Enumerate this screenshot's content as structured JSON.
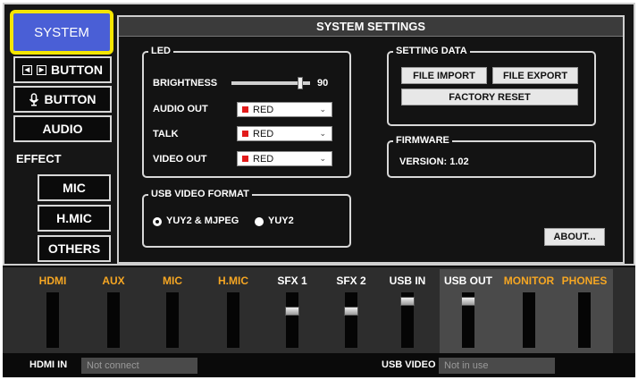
{
  "nav": {
    "system": "SYSTEM",
    "button": "BUTTON",
    "vbutton": "BUTTON",
    "audio": "AUDIO",
    "effect": "EFFECT",
    "mic": "MIC",
    "hmic": "H.MIC",
    "others": "OTHERS"
  },
  "main": {
    "title": "SYSTEM SETTINGS"
  },
  "led": {
    "title": "LED",
    "brightness_label": "BRIGHTNESS",
    "brightness_value": "90",
    "brightness_level": 0.9,
    "audio_out_label": "AUDIO OUT",
    "audio_out_value": "RED",
    "talk_label": "TALK",
    "talk_value": "RED",
    "video_out_label": "VIDEO OUT",
    "video_out_value": "RED",
    "swatch_color": "#e21b1b"
  },
  "usb_format": {
    "title": "USB VIDEO FORMAT",
    "option1": "YUY2 & MJPEG",
    "option2": "YUY2",
    "selected": "YUY2 & MJPEG"
  },
  "setting_data": {
    "title": "SETTING DATA",
    "file_import": "FILE IMPORT",
    "file_export": "FILE EXPORT",
    "factory_reset": "FACTORY RESET"
  },
  "firmware": {
    "title": "FIRMWARE",
    "version": "VERSION: 1.02"
  },
  "about": "ABOUT...",
  "mixer": {
    "channels": [
      {
        "label": "HDMI",
        "color": "#f5a623",
        "fader": null
      },
      {
        "label": "AUX",
        "color": "#f5a623",
        "fader": null
      },
      {
        "label": "MIC",
        "color": "#f5a623",
        "fader": null
      },
      {
        "label": "H.MIC",
        "color": "#f5a623",
        "fader": null
      },
      {
        "label": "SFX 1",
        "color": "#ffffff",
        "fader": 0.7
      },
      {
        "label": "SFX 2",
        "color": "#ffffff",
        "fader": 0.7
      },
      {
        "label": "USB IN",
        "color": "#ffffff",
        "fader": 0.9
      },
      {
        "label": "USB OUT",
        "color": "#ffffff",
        "fader": 0.9
      },
      {
        "label": "MONITOR",
        "color": "#f5a623",
        "fader": null
      },
      {
        "label": "PHONES",
        "color": "#f5a623",
        "fader": null
      }
    ]
  },
  "status": {
    "hdmi_in_label": "HDMI IN",
    "hdmi_in_value": "Not connect",
    "usb_video_label": "USB VIDEO",
    "usb_video_value": "Not in use"
  }
}
